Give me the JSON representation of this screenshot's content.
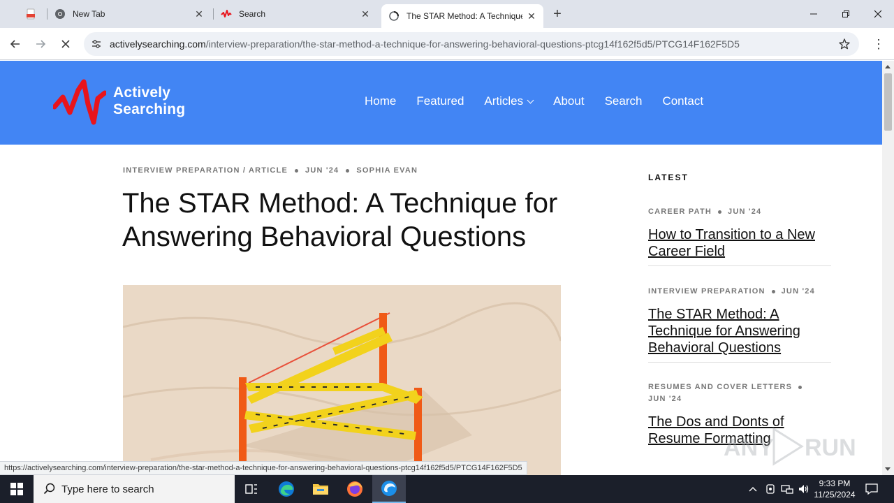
{
  "browser": {
    "tabs": [
      {
        "title": "",
        "icon": "pdf-icon"
      },
      {
        "title": "New Tab",
        "icon": "chrome-icon"
      },
      {
        "title": "Search",
        "icon": "activelysearching-icon"
      },
      {
        "title": "The STAR Method: A Technique",
        "icon": "loading-globe-icon",
        "active": true
      }
    ],
    "url_domain": "activelysearching.com",
    "url_path": "/interview-preparation/the-star-method-a-technique-for-answering-behavioral-questions-ptcg14f162f5d5/PTCG14F162F5D5",
    "status_url": "https://activelysearching.com/interview-preparation/the-star-method-a-technique-for-answering-behavioral-questions-ptcg14f162f5d5/PTCG14F162F5D5"
  },
  "site": {
    "logo_line1": "Actively",
    "logo_line2": "Searching",
    "brand_color": "#4285f4",
    "logo_mark_color": "#e8141c",
    "nav": [
      "Home",
      "Featured",
      "Articles",
      "About",
      "Search",
      "Contact"
    ]
  },
  "article": {
    "category": "INTERVIEW PREPARATION / ARTICLE",
    "date": "JUN '24",
    "author": "SOPHIA EVAN",
    "title": "The STAR Method: A Technique for Answering Behavioral Questions"
  },
  "sidebar": {
    "heading": "LATEST",
    "items": [
      {
        "category": "CAREER PATH",
        "date": "JUN '24",
        "title": "How to Transition to a New Career Field"
      },
      {
        "category": "INTERVIEW PREPARATION",
        "date": "JUN '24",
        "title": "The STAR Method: A Technique for Answering Behavioral Questions"
      },
      {
        "category": "RESUMES AND COVER LETTERS",
        "date": "JUN '24",
        "title": "The Dos and Donts of Resume Formatting"
      }
    ]
  },
  "watermark": {
    "left": "ANY",
    "right": "RUN"
  },
  "taskbar": {
    "search_placeholder": "Type here to search",
    "time": "9:33 PM",
    "date": "11/25/2024",
    "apps": [
      "task-view-icon",
      "edge-icon",
      "file-explorer-icon",
      "firefox-icon",
      "edge-active-icon"
    ]
  }
}
